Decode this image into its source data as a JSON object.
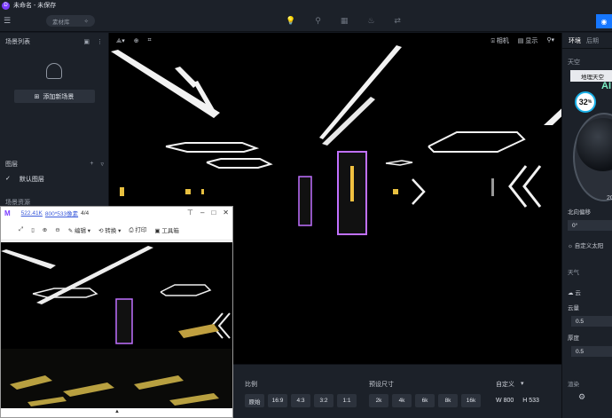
{
  "titlebar": {
    "title": "未命名 - 未保存"
  },
  "toolbar": {
    "material_lib": "素材库"
  },
  "left_panel": {
    "scene_list_title": "场景列表",
    "add_scene_label": "添加新场景",
    "layers_title": "图层",
    "default_layer": "默认图层",
    "assets_title": "场景资源"
  },
  "viewport": {
    "camera_label": "相机",
    "display_label": "显示"
  },
  "bottom_bar": {
    "ratio_title": "比例",
    "ratios": [
      "原始",
      "16:9",
      "4:3",
      "3:2",
      "1:1"
    ],
    "preset_title": "预设尺寸",
    "presets": [
      "2k",
      "4k",
      "6k",
      "8k",
      "16k"
    ],
    "custom_title": "自定义",
    "width_label": "W",
    "width_value": "800",
    "height_label": "H",
    "height_value": "533",
    "render_title": "渲染"
  },
  "right_panel": {
    "tab_env": "环境",
    "tab_post": "后期",
    "sky_title": "天空",
    "sky_select": "地理天空",
    "percent": "32",
    "percent_sign": "%",
    "ai_text": "AI",
    "big_number": "20",
    "north_offset_title": "北向偏移",
    "north_offset_value": "0°",
    "custom_sun": "自定义太阳",
    "weather_title": "天气",
    "cloud_label": "云",
    "cloud_amount_title": "云量",
    "cloud_amount_value": "0.5",
    "thickness_title": "厚度",
    "thickness_value": "0.5"
  },
  "viewer": {
    "size_text": "522.41K",
    "dims_text": "800*533像素",
    "page_text": "4/4",
    "edit_label": "编辑",
    "convert_label": "转换",
    "print_label": "打印",
    "toolbox_label": "工具箱"
  }
}
